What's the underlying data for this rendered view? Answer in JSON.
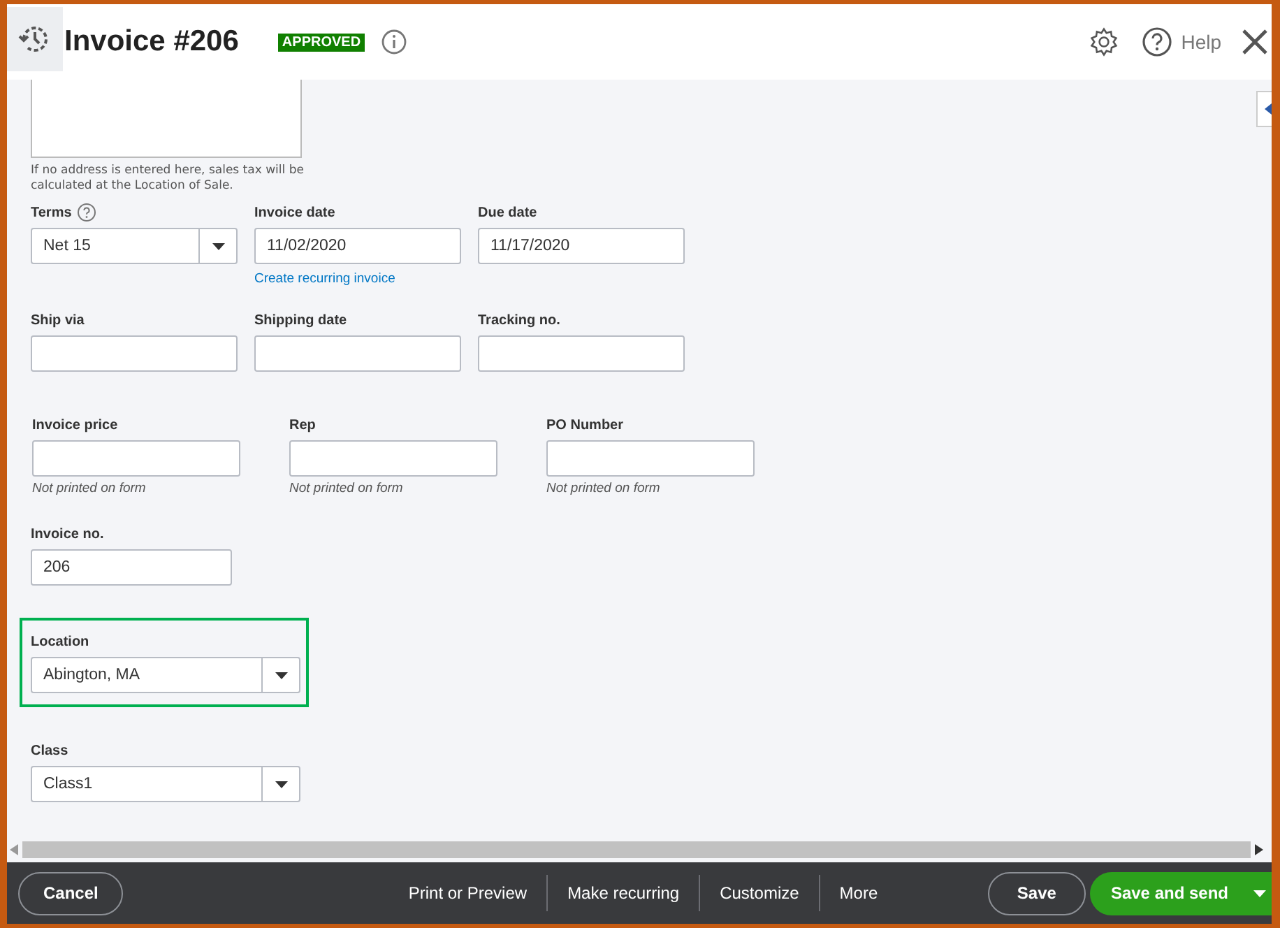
{
  "header": {
    "title": "Invoice #206",
    "status": "APPROVED",
    "help": "Help"
  },
  "address_note": "If no address is entered here, sales tax will be calculated at the Location of Sale.",
  "rows": [
    {
      "kind": "wide",
      "fields": [
        {
          "kind": "select",
          "label": "Terms",
          "help_icon": true,
          "value": "Net 15"
        },
        {
          "kind": "text",
          "label": "Invoice date",
          "value": "11/02/2020",
          "link": "Create recurring invoice"
        },
        {
          "kind": "text",
          "label": "Due date",
          "value": "11/17/2020"
        }
      ]
    },
    {
      "kind": "wide",
      "fields": [
        {
          "kind": "text",
          "label": "Ship via"
        },
        {
          "kind": "text",
          "label": "Shipping date"
        },
        {
          "kind": "text",
          "label": "Tracking no."
        }
      ]
    },
    {
      "kind": "custom",
      "fields": [
        {
          "kind": "text",
          "label": "Invoice price",
          "hint": "Not printed on form"
        },
        {
          "kind": "text",
          "label": "Rep",
          "hint": "Not printed on form"
        },
        {
          "kind": "text",
          "label": "PO Number",
          "hint": "Not printed on form"
        }
      ]
    },
    {
      "kind": "single",
      "fields": [
        {
          "kind": "text",
          "label": "Invoice no.",
          "value": "206"
        }
      ]
    },
    {
      "kind": "single",
      "highlighted": true,
      "fields": [
        {
          "kind": "select",
          "label": "Location",
          "value": "Abington, MA"
        }
      ]
    },
    {
      "kind": "single",
      "fields": [
        {
          "kind": "select",
          "label": "Class",
          "value": "Class1"
        }
      ]
    }
  ],
  "footer": {
    "cancel": "Cancel",
    "actions": [
      "Print or Preview",
      "Make recurring",
      "Customize",
      "More"
    ],
    "save": "Save",
    "save_and_send": "Save and send"
  }
}
